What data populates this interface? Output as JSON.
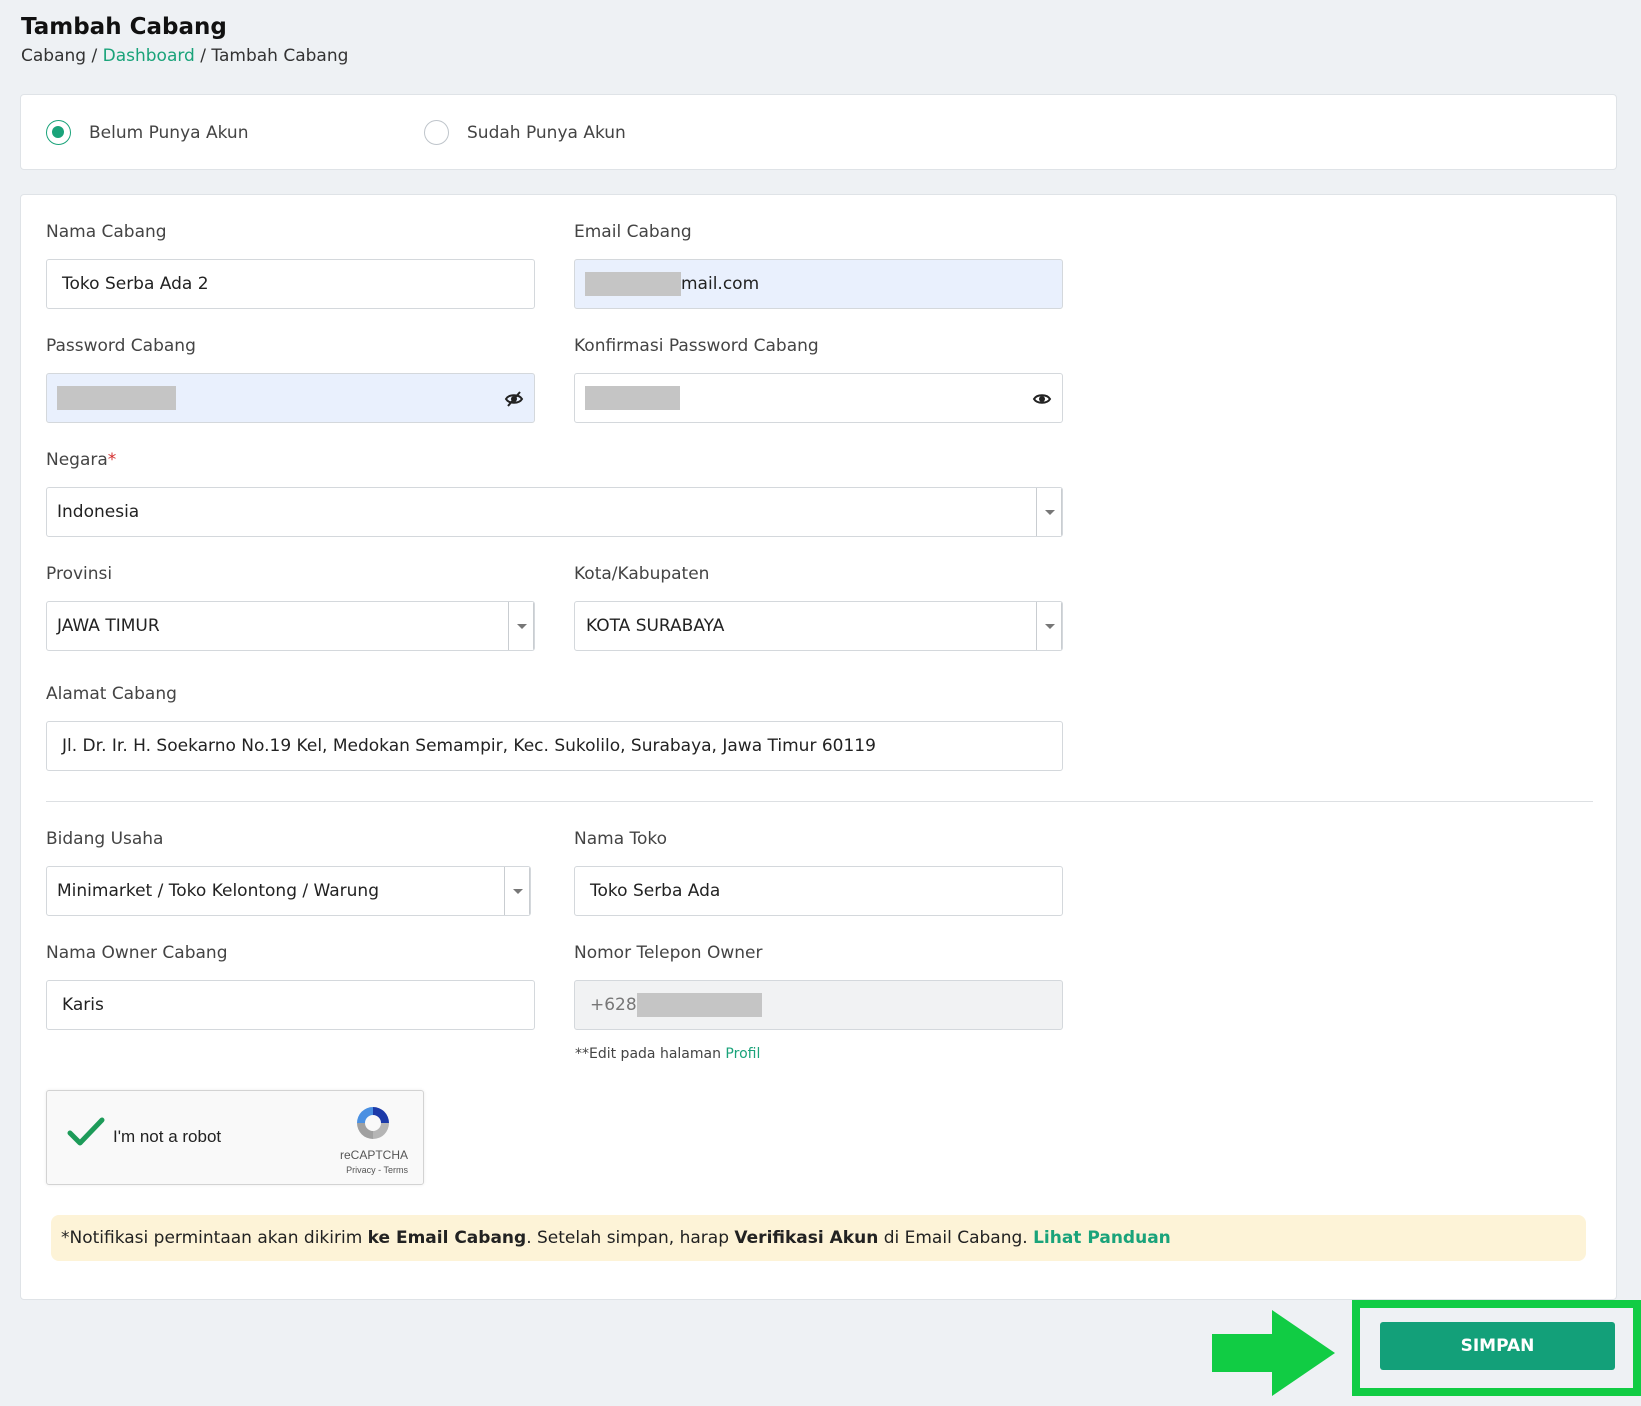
{
  "header": {
    "title": "Tambah Cabang",
    "breadcrumb": [
      "Cabang",
      "Dashboard",
      "Tambah Cabang"
    ]
  },
  "account_type": {
    "options": [
      "Belum Punya Akun",
      "Sudah Punya Akun"
    ],
    "selected": "Belum Punya Akun"
  },
  "form": {
    "nama_cabang": {
      "label": "Nama Cabang",
      "value": "Toko Serba Ada 2"
    },
    "email_cabang": {
      "label": "Email Cabang",
      "value_visible": "mail.com"
    },
    "password_cabang": {
      "label": "Password Cabang"
    },
    "konfirmasi_password": {
      "label": "Konfirmasi Password Cabang"
    },
    "negara": {
      "label": "Negara",
      "required_mark": "*",
      "value": "Indonesia"
    },
    "provinsi": {
      "label": "Provinsi",
      "value": "JAWA TIMUR"
    },
    "kota": {
      "label": "Kota/Kabupaten",
      "value": "KOTA SURABAYA"
    },
    "alamat": {
      "label": "Alamat Cabang",
      "value": "Jl. Dr. Ir. H. Soekarno No.19 Kel, Medokan Semampir, Kec. Sukolilo, Surabaya, Jawa Timur 60119"
    },
    "bidang_usaha": {
      "label": "Bidang Usaha",
      "value": "Minimarket / Toko Kelontong / Warung"
    },
    "nama_toko": {
      "label": "Nama Toko",
      "value": "Toko Serba Ada"
    },
    "nama_owner": {
      "label": "Nama Owner Cabang",
      "value": "Karis"
    },
    "telepon_owner": {
      "label": "Nomor Telepon Owner",
      "value_visible": "+628",
      "hint_prefix": "**Edit pada halaman",
      "hint_link": "Profil"
    }
  },
  "captcha": {
    "text": "I'm not a robot",
    "brand": "reCAPTCHA",
    "terms": "Privacy - Terms",
    "checked": true
  },
  "notice": {
    "part1": "*Notifikasi permintaan akan dikirim ",
    "bold1": "ke Email Cabang",
    "part2": ". Setelah simpan, harap ",
    "bold2": "Verifikasi Akun",
    "part3": " di Email Cabang. ",
    "link": "Lihat Panduan"
  },
  "actions": {
    "save_label": "SIMPAN"
  },
  "colors": {
    "accent": "#1aa37a",
    "highlight": "#11cc44",
    "notice_bg": "#fdf3d7"
  }
}
